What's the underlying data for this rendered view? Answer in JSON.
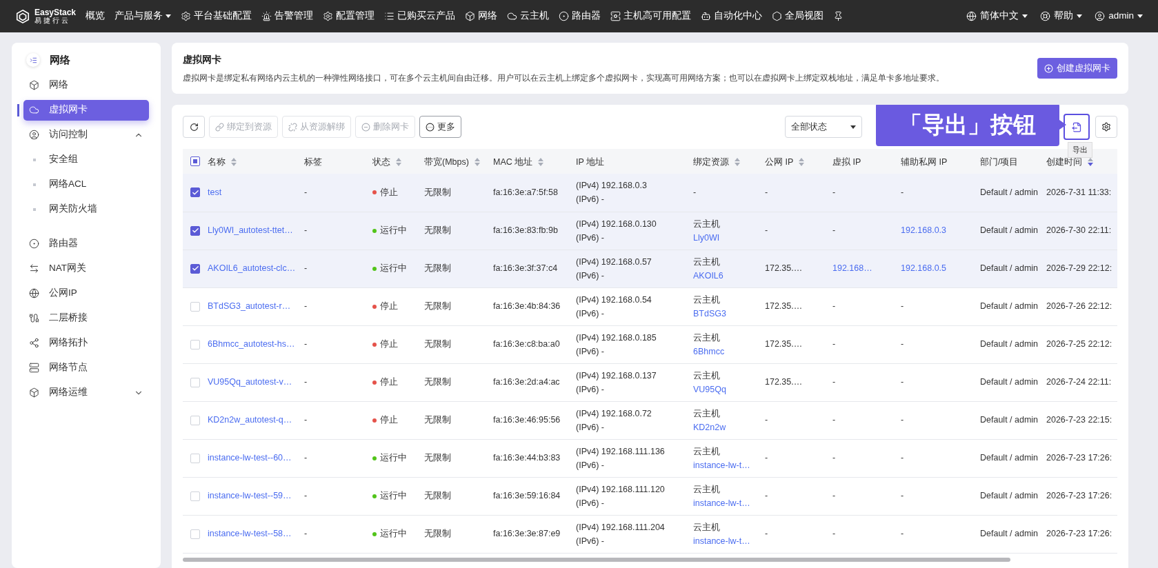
{
  "topbar": {
    "logo": {
      "name": "EasyStack",
      "subtitle": "易捷行云"
    },
    "items": [
      {
        "label": "概览",
        "dropdown": false
      },
      {
        "label": "产品与服务",
        "dropdown": true
      },
      {
        "label": "平台基础配置",
        "dropdown": false
      },
      {
        "label": "告警管理",
        "dropdown": false
      },
      {
        "label": "配置管理",
        "dropdown": false
      },
      {
        "label": "已购买云产品",
        "dropdown": false
      },
      {
        "label": "网络",
        "dropdown": false
      },
      {
        "label": "云主机",
        "dropdown": false
      },
      {
        "label": "路由器",
        "dropdown": false
      },
      {
        "label": "主机高可用配置",
        "dropdown": false
      },
      {
        "label": "自动化中心",
        "dropdown": false
      },
      {
        "label": "全局视图",
        "dropdown": false
      }
    ],
    "right": [
      {
        "label": "简体中文"
      },
      {
        "label": "帮助"
      },
      {
        "label": "admin"
      }
    ]
  },
  "sidebar": {
    "title": "网络",
    "items": [
      {
        "label": "网络",
        "kind": "item",
        "selected": false
      },
      {
        "label": "虚拟网卡",
        "kind": "item",
        "selected": true
      },
      {
        "label": "访问控制",
        "kind": "group",
        "selected": false,
        "expanded": true,
        "children": [
          {
            "label": "安全组",
            "kind": "sub",
            "selected": false
          },
          {
            "label": "网络ACL",
            "kind": "sub",
            "selected": false
          },
          {
            "label": "网关防火墙",
            "kind": "sub",
            "selected": false
          }
        ]
      },
      {
        "label": "路由器",
        "kind": "item",
        "selected": false
      },
      {
        "label": "NAT网关",
        "kind": "item",
        "selected": false
      },
      {
        "label": "公网IP",
        "kind": "item",
        "selected": false
      },
      {
        "label": "二层桥接",
        "kind": "item",
        "selected": false
      },
      {
        "label": "网络拓扑",
        "kind": "item",
        "selected": false
      },
      {
        "label": "网络节点",
        "kind": "item",
        "selected": false
      },
      {
        "label": "网络运维",
        "kind": "group",
        "selected": false,
        "expanded": false
      }
    ]
  },
  "header": {
    "title": "虚拟网卡",
    "description": "虚拟网卡是绑定私有网络内云主机的一种弹性网络接口，可在多个云主机间自由迁移。用户可以在云主机上绑定多个虚拟网卡，实现高可用网络方案；也可以在虚拟网卡上绑定双栈地址，满足单卡多地址要求。",
    "create_button": "创建虚拟网卡"
  },
  "toolbar": {
    "buttons": [
      {
        "label": "绑定到资源",
        "disabled": true
      },
      {
        "label": "从资源解绑",
        "disabled": true
      },
      {
        "label": "删除网卡",
        "disabled": true
      },
      {
        "label": "更多",
        "disabled": false
      }
    ],
    "status_filter": "全部状态",
    "callout": "「导出」按钮",
    "export_tooltip": "导出"
  },
  "table": {
    "select_all_partial": true,
    "columns": [
      {
        "label": "名称",
        "sortable": true,
        "sorted": false
      },
      {
        "label": "标签",
        "sortable": false,
        "sorted": false
      },
      {
        "label": "状态",
        "sortable": true,
        "sorted": false
      },
      {
        "label": "带宽(Mbps)",
        "sortable": true,
        "sorted": false
      },
      {
        "label": "MAC 地址",
        "sortable": true,
        "sorted": false
      },
      {
        "label": "IP 地址",
        "sortable": false,
        "sorted": false
      },
      {
        "label": "绑定资源",
        "sortable": true,
        "sorted": false
      },
      {
        "label": "公网 IP",
        "sortable": true,
        "sorted": false
      },
      {
        "label": "虚拟 IP",
        "sortable": false,
        "sorted": false
      },
      {
        "label": "辅助私网 IP",
        "sortable": false,
        "sorted": false
      },
      {
        "label": "部门/项目",
        "sortable": false,
        "sorted": false
      },
      {
        "label": "创建时间",
        "sortable": true,
        "sorted": true
      }
    ],
    "rows": [
      {
        "checked": true,
        "name": "test",
        "tag": "-",
        "status": "停止",
        "color": "#e5534b",
        "bandwidth": "无限制",
        "mac": "fa:16:3e:a7:5f:58",
        "ipv4": "(IPv4) 192.168.0.3",
        "ipv6": "(IPv6) -",
        "bound": "-",
        "public_ip": "-",
        "virtual_ip": "-",
        "aux_ip": "-",
        "dept": "Default / admin",
        "created": "2026-7-31 11:33:"
      },
      {
        "checked": true,
        "name": "Lly0WI_autotest-ttet…",
        "tag": "-",
        "status": "运行中",
        "color": "#52c41a",
        "bandwidth": "无限制",
        "mac": "fa:16:3e:83:fb:9b",
        "ipv4": "(IPv4) 192.168.0.130",
        "ipv6": "(IPv6) -",
        "bound_type": "云主机",
        "bound": "Lly0WI",
        "public_ip": "-",
        "virtual_ip": "-",
        "aux_ip": "192.168.0.3",
        "dept": "Default / admin",
        "created": "2026-7-30 22:11:"
      },
      {
        "checked": true,
        "name": "AKOIL6_autotest-clc…",
        "tag": "-",
        "status": "运行中",
        "color": "#52c41a",
        "bandwidth": "无限制",
        "mac": "fa:16:3e:3f:37:c4",
        "ipv4": "(IPv4) 192.168.0.57",
        "ipv6": "(IPv6) -",
        "bound_type": "云主机",
        "bound": "AKOIL6",
        "public_ip": "172.35.…",
        "virtual_ip": "192.168…",
        "aux_ip": "192.168.0.5",
        "dept": "Default / admin",
        "created": "2026-7-29 22:12:"
      },
      {
        "checked": false,
        "name": "BTdSG3_autotest-r…",
        "tag": "-",
        "status": "停止",
        "color": "#e5534b",
        "bandwidth": "无限制",
        "mac": "fa:16:3e:4b:84:36",
        "ipv4": "(IPv4) 192.168.0.54",
        "ipv6": "(IPv6) -",
        "bound_type": "云主机",
        "bound": "BTdSG3",
        "public_ip": "172.35.…",
        "virtual_ip": "-",
        "aux_ip": "-",
        "dept": "Default / admin",
        "created": "2026-7-26 22:12:"
      },
      {
        "checked": false,
        "name": "6Bhmcc_autotest-hs…",
        "tag": "-",
        "status": "停止",
        "color": "#e5534b",
        "bandwidth": "无限制",
        "mac": "fa:16:3e:c8:ba:a0",
        "ipv4": "(IPv4) 192.168.0.185",
        "ipv6": "(IPv6) -",
        "bound_type": "云主机",
        "bound": "6Bhmcc",
        "public_ip": "172.35.…",
        "virtual_ip": "-",
        "aux_ip": "-",
        "dept": "Default / admin",
        "created": "2026-7-25 22:12:"
      },
      {
        "checked": false,
        "name": "VU95Qq_autotest-v…",
        "tag": "-",
        "status": "停止",
        "color": "#e5534b",
        "bandwidth": "无限制",
        "mac": "fa:16:3e:2d:a4:ac",
        "ipv4": "(IPv4) 192.168.0.137",
        "ipv6": "(IPv6) -",
        "bound_type": "云主机",
        "bound": "VU95Qq",
        "public_ip": "172.35.…",
        "virtual_ip": "-",
        "aux_ip": "-",
        "dept": "Default / admin",
        "created": "2026-7-24 22:11:"
      },
      {
        "checked": false,
        "name": "KD2n2w_autotest-q…",
        "tag": "-",
        "status": "停止",
        "color": "#e5534b",
        "bandwidth": "无限制",
        "mac": "fa:16:3e:46:95:56",
        "ipv4": "(IPv4) 192.168.0.72",
        "ipv6": "(IPv6) -",
        "bound_type": "云主机",
        "bound": "KD2n2w",
        "public_ip": "-",
        "virtual_ip": "-",
        "aux_ip": "-",
        "dept": "Default / admin",
        "created": "2026-7-23 22:15:"
      },
      {
        "checked": false,
        "name": "instance-lw-test--60…",
        "tag": "-",
        "status": "运行中",
        "color": "#52c41a",
        "bandwidth": "无限制",
        "mac": "fa:16:3e:44:b3:83",
        "ipv4": "(IPv4) 192.168.111.136",
        "ipv6": "(IPv6) -",
        "bound_type": "云主机",
        "bound": "instance-lw-t…",
        "public_ip": "-",
        "virtual_ip": "-",
        "aux_ip": "-",
        "dept": "Default / admin",
        "created": "2026-7-23 17:26:"
      },
      {
        "checked": false,
        "name": "instance-lw-test--59…",
        "tag": "-",
        "status": "运行中",
        "color": "#52c41a",
        "bandwidth": "无限制",
        "mac": "fa:16:3e:59:16:84",
        "ipv4": "(IPv4) 192.168.111.120",
        "ipv6": "(IPv6) -",
        "bound_type": "云主机",
        "bound": "instance-lw-t…",
        "public_ip": "-",
        "virtual_ip": "-",
        "aux_ip": "-",
        "dept": "Default / admin",
        "created": "2026-7-23 17:26:"
      },
      {
        "checked": false,
        "name": "instance-lw-test--58…",
        "tag": "-",
        "status": "运行中",
        "color": "#52c41a",
        "bandwidth": "无限制",
        "mac": "fa:16:3e:3e:87:e9",
        "ipv4": "(IPv4) 192.168.111.204",
        "ipv6": "(IPv6) -",
        "bound_type": "云主机",
        "bound": "instance-lw-t…",
        "public_ip": "-",
        "virtual_ip": "-",
        "aux_ip": "-",
        "dept": "Default / admin",
        "created": "2026-7-23 17:26:"
      }
    ]
  }
}
